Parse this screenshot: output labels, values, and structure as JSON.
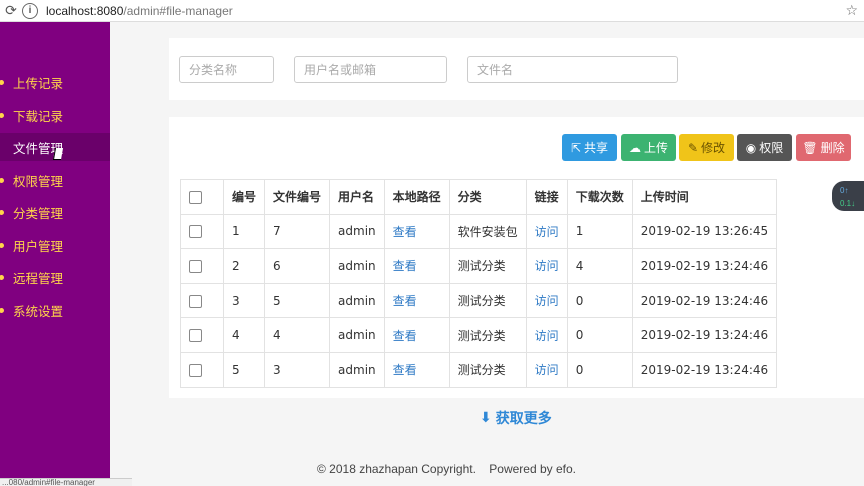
{
  "browser": {
    "url_host": "localhost:8080",
    "url_path": "/admin#file-manager",
    "status_text": "...080/admin#file-manager"
  },
  "sidebar": {
    "items": [
      {
        "label": "上传记录",
        "active": false
      },
      {
        "label": "下载记录",
        "active": false
      },
      {
        "label": "文件管理",
        "active": true
      },
      {
        "label": "权限管理",
        "active": false
      },
      {
        "label": "分类管理",
        "active": false
      },
      {
        "label": "用户管理",
        "active": false
      },
      {
        "label": "远程管理",
        "active": false
      },
      {
        "label": "系统设置",
        "active": false
      }
    ]
  },
  "search": {
    "category_placeholder": "分类名称",
    "user_placeholder": "用户名或邮箱",
    "filename_placeholder": "文件名"
  },
  "toolbar": {
    "share_label": "共享",
    "upload_label": "上传",
    "edit_label": "修改",
    "perm_label": "权限",
    "delete_label": "删除"
  },
  "table": {
    "headers": [
      "编号",
      "文件编号",
      "用户名",
      "本地路径",
      "分类",
      "链接",
      "下载次数",
      "上传时间"
    ],
    "rows": [
      {
        "id": "1",
        "file_id": "7",
        "user": "admin",
        "path": "查看",
        "category": "软件安装包",
        "link": "访问",
        "downloads": "1",
        "time": "2019-02-19 13:26:45"
      },
      {
        "id": "2",
        "file_id": "6",
        "user": "admin",
        "path": "查看",
        "category": "测试分类",
        "link": "访问",
        "downloads": "4",
        "time": "2019-02-19 13:24:46"
      },
      {
        "id": "3",
        "file_id": "5",
        "user": "admin",
        "path": "查看",
        "category": "测试分类",
        "link": "访问",
        "downloads": "0",
        "time": "2019-02-19 13:24:46"
      },
      {
        "id": "4",
        "file_id": "4",
        "user": "admin",
        "path": "查看",
        "category": "测试分类",
        "link": "访问",
        "downloads": "0",
        "time": "2019-02-19 13:24:46"
      },
      {
        "id": "5",
        "file_id": "3",
        "user": "admin",
        "path": "查看",
        "category": "测试分类",
        "link": "访问",
        "downloads": "0",
        "time": "2019-02-19 13:24:46"
      }
    ]
  },
  "load_more_label": "获取更多",
  "footer": "© 2018 zhazhapan Copyright.    Powered by efo.",
  "widget": {
    "up": "0↑",
    "down": "0.1↓"
  },
  "colors": {
    "sidebar": "#800080",
    "nav_text": "#ffd54a",
    "share": "#2f9ae0",
    "upload": "#3cb371",
    "edit": "#f0c419",
    "perm": "#555555",
    "delete": "#e06870",
    "link": "#2f7ac5"
  }
}
